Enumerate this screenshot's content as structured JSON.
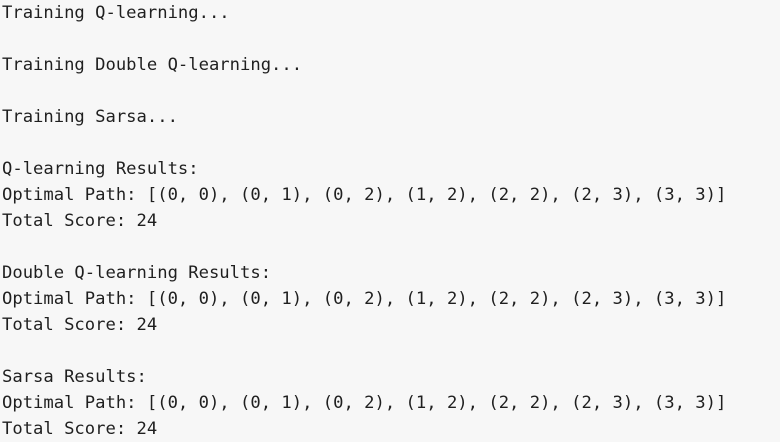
{
  "output": {
    "lines": [
      "Training Q-learning...",
      "",
      "Training Double Q-learning...",
      "",
      "Training Sarsa...",
      "",
      "Q-learning Results:",
      "Optimal Path: [(0, 0), (0, 1), (0, 2), (1, 2), (2, 2), (2, 3), (3, 3)]",
      "Total Score: 24",
      "",
      "Double Q-learning Results:",
      "Optimal Path: [(0, 0), (0, 1), (0, 2), (1, 2), (2, 2), (2, 3), (3, 3)]",
      "Total Score: 24",
      "",
      "Sarsa Results:",
      "Optimal Path: [(0, 0), (0, 1), (0, 2), (1, 2), (2, 2), (2, 3), (3, 3)]",
      "Total Score: 24"
    ]
  }
}
